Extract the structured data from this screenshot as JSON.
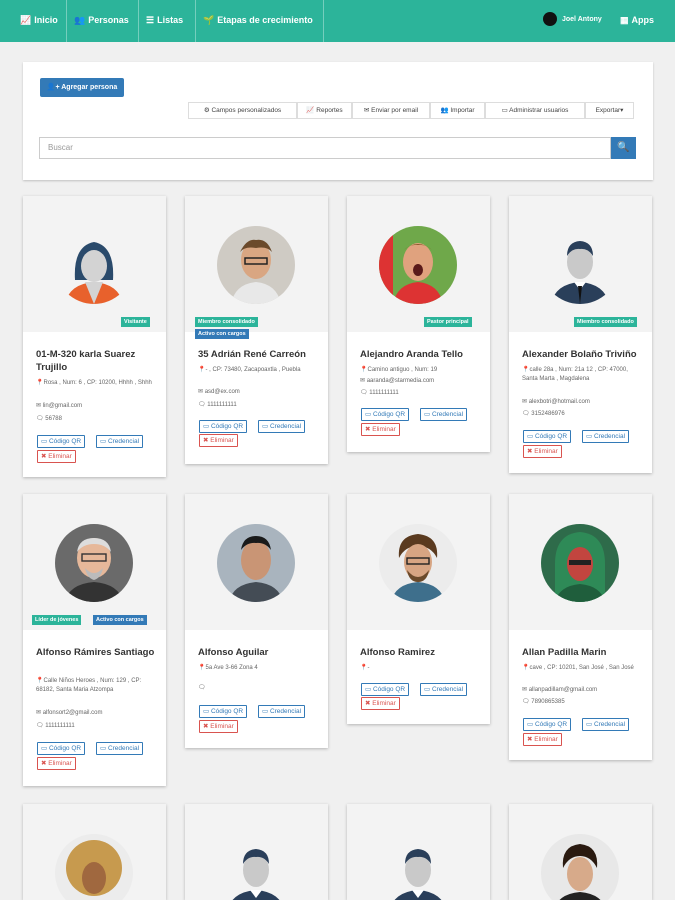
{
  "nav": {
    "items": [
      {
        "label": "Inicio",
        "icon": "line-chart-icon"
      },
      {
        "label": "Personas",
        "icon": "users-icon"
      },
      {
        "label": "Listas",
        "icon": "list-icon"
      },
      {
        "label": "Etapas de crecimiento",
        "icon": "seedling-icon"
      }
    ],
    "user_name": "Joel Antony",
    "apps_label": "Apps"
  },
  "toolbar": {
    "add_person": "Agregar persona",
    "buttons": [
      "Campos personalizados",
      "Reportes",
      "Enviar por email",
      "Importar",
      "Administrar usuarios",
      "Exportar▾"
    ],
    "search_placeholder": "Buscar"
  },
  "card_actions": {
    "qr": "Código QR",
    "credential": "Credencial",
    "delete": "Eliminar"
  },
  "people": [
    {
      "badges": [
        "Visitante"
      ],
      "name": "01-M-320 karla Suarez Trujillo",
      "address": "Rosa , Num: 6 , CP: 10200, Hhhh , Shhh",
      "email": "lin@gmail.com",
      "phone": "56788",
      "avatar": "female-silhouette"
    },
    {
      "badges": [
        "Miembro consolidado",
        "Activo con cargos"
      ],
      "name": "35 Adrián René Carreón",
      "address": "- , CP: 73480, Zacapoaxtla , Puebla",
      "email": "asd@ex.com",
      "phone": "1111111111",
      "avatar": "photo"
    },
    {
      "badges": [
        "Pastor principal"
      ],
      "name": "Alejandro Aranda Tello",
      "address": "Camino antiguo , Num: 19",
      "email": "aaranda@starmedia.com",
      "phone": "1111111111",
      "avatar": "photo"
    },
    {
      "badges": [
        "Miembro consolidado"
      ],
      "name": "Alexander Bolaño Triviño",
      "address": "calle 28a , Num: 21a 12 , CP: 47000, Santa Marta , Magdalena",
      "email": "alexbotri@hotmail.com",
      "phone": "3152486976",
      "avatar": "male-silhouette"
    },
    {
      "badges": [
        "Líder de jóvenes",
        "Activo con cargos"
      ],
      "name": "Alfonso Rámires Santiago",
      "address": "Calle Niños Heroes , Num: 129 , CP: 68182, Santa Maria Atzompa",
      "email": "alfonsort2@gmail.com",
      "phone": "1111111111",
      "avatar": "photo"
    },
    {
      "badges": [],
      "name": "Alfonso Aguilar",
      "address": "5a Ave 3-66 Zona 4",
      "email": "",
      "phone": "",
      "avatar": "photo"
    },
    {
      "badges": [],
      "name": "Alfonso Ramirez",
      "address": "-",
      "email": "",
      "phone": "",
      "avatar": "photo"
    },
    {
      "badges": [],
      "name": "Allan Padilla Marin",
      "address": "cave , CP: 10201, San José , San José",
      "email": "allanpadillam@gmail.com",
      "phone": "7890865385",
      "avatar": "photo"
    }
  ],
  "colors": {
    "accent": "#2cb49a",
    "primary": "#337ab7",
    "danger": "#d9534f"
  }
}
